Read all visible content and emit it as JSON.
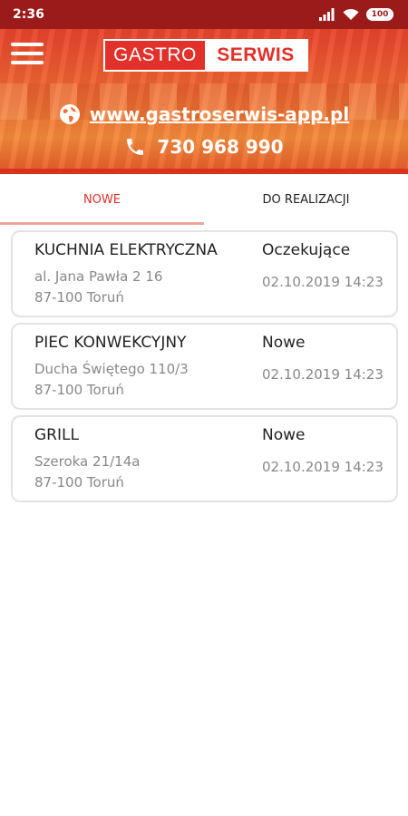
{
  "status_bar": {
    "time": "2:36",
    "battery": "100",
    "icons": [
      "signal-icon",
      "wifi-icon",
      "battery-icon"
    ]
  },
  "header": {
    "logo_left": "GASTRO",
    "logo_right": "SERWIS",
    "website": "www.gastroserwis-app.pl",
    "phone": "730 968 990",
    "colors": {
      "brand_red": "#e2302a",
      "status_bar": "#9b1a1a"
    }
  },
  "tabs": [
    {
      "label": "NOWE",
      "active": true
    },
    {
      "label": "DO REALIZACJI",
      "active": false
    }
  ],
  "orders": [
    {
      "name": "KUCHNIA ELEKTRYCZNA",
      "street": "al. Jana Pawła 2 16",
      "city": "87-100 Toruń",
      "status": "Oczekujące",
      "date": "02.10.2019 14:23"
    },
    {
      "name": "PIEC KONWEKCYJNY",
      "street": "Ducha Świętego 110/3",
      "city": "87-100 Toruń",
      "status": "Nowe",
      "date": "02.10.2019 14:23"
    },
    {
      "name": "GRILL",
      "street": "Szeroka 21/14a",
      "city": "87-100 Toruń",
      "status": "Nowe",
      "date": "02.10.2019 14:23"
    }
  ]
}
